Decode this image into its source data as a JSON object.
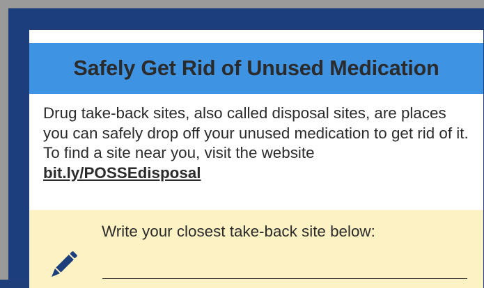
{
  "card": {
    "title": "Safely Get Rid of Unused Medication",
    "body_text": "Drug take-back sites, also called disposal sites, are places you can safely drop off your unused medication to get rid of it. To find a site near you, visit the website ",
    "link_text": "bit.ly/POSSEdisposal"
  },
  "write_box": {
    "label": "Write your closest take-back site below:",
    "icon": "pencil-icon"
  },
  "colors": {
    "frame": "#1d3e7c",
    "heading_bar": "#3f93e3",
    "write_box": "#fdf2c4",
    "text": "#2b2b2b"
  }
}
